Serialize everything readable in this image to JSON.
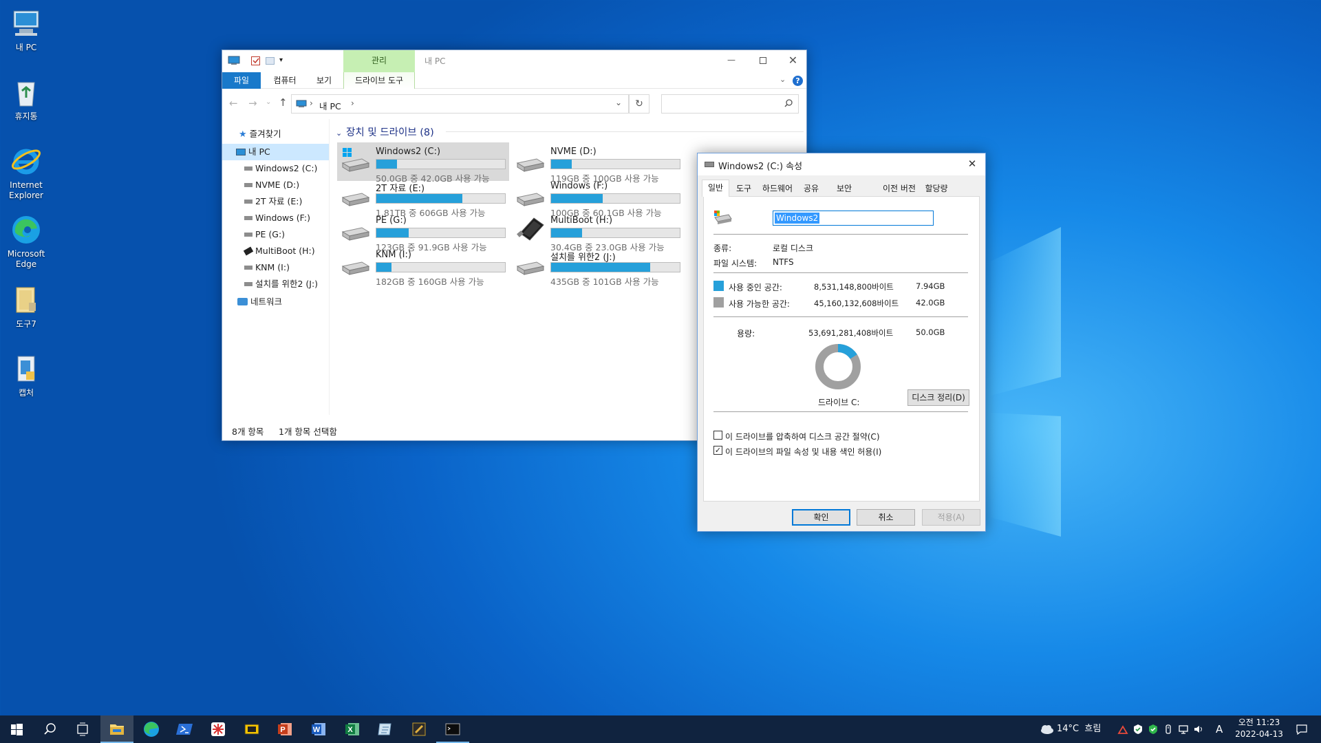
{
  "desktop": {
    "icons": [
      {
        "name": "my-pc",
        "label": "내 PC"
      },
      {
        "name": "recycle-bin",
        "label": "휴지통"
      },
      {
        "name": "internet-explorer",
        "label": "Internet Explorer"
      },
      {
        "name": "microsoft-edge",
        "label": "Microsoft Edge"
      },
      {
        "name": "tools-folder",
        "label": "도구7"
      },
      {
        "name": "capture",
        "label": "캡처"
      }
    ]
  },
  "explorer": {
    "title": "내 PC",
    "context_tab": "관리",
    "ribbon_tabs": [
      "파일",
      "컴퓨터",
      "보기",
      "드라이브 도구"
    ],
    "address": {
      "root": "내 PC"
    },
    "nav": {
      "favorites": "즐겨찾기",
      "this_pc": "내 PC",
      "drives": [
        "Windows2 (C:)",
        "NVME (D:)",
        "2T 자료 (E:)",
        "Windows (F:)",
        "PE (G:)",
        "MultiBoot (H:)",
        "KNM (I:)",
        "설치를 위한2 (J:)"
      ],
      "network": "네트워크"
    },
    "group_header": "장치 및 드라이브 (8)",
    "drives": [
      {
        "name": "Windows2 (C:)",
        "free_text": "50.0GB 중 42.0GB 사용 가능",
        "used_fraction": 0.16,
        "selected": true
      },
      {
        "name": "NVME (D:)",
        "free_text": "119GB 중 100GB 사용 가능",
        "used_fraction": 0.16
      },
      {
        "name": "2T 자료 (E:)",
        "free_text": "1.81TB 중 606GB 사용 가능",
        "used_fraction": 0.67
      },
      {
        "name": "Windows (F:)",
        "free_text": "100GB 중 60.1GB 사용 가능",
        "used_fraction": 0.4
      },
      {
        "name": "PE (G:)",
        "free_text": "123GB 중 91.9GB 사용 가능",
        "used_fraction": 0.25
      },
      {
        "name": "MultiBoot (H:)",
        "free_text": "30.4GB 중 23.0GB 사용 가능",
        "used_fraction": 0.24
      },
      {
        "name": "KNM (I:)",
        "free_text": "182GB 중 160GB 사용 가능",
        "used_fraction": 0.12
      },
      {
        "name": "설치를 위한2 (J:)",
        "free_text": "435GB 중 101GB 사용 가능",
        "used_fraction": 0.77
      }
    ],
    "status": {
      "items": "8개 항목",
      "selected": "1개 항목 선택함"
    }
  },
  "props": {
    "title": "Windows2 (C:) 속성",
    "tabs": [
      "일반",
      "도구",
      "하드웨어",
      "공유",
      "보안",
      "이전 버전",
      "할당량"
    ],
    "volume_name": "Windows2",
    "type_label": "종류:",
    "type_value": "로컬 디스크",
    "fs_label": "파일 시스템:",
    "fs_value": "NTFS",
    "used_label": "사용 중인 공간:",
    "used_bytes": "8,531,148,800바이트",
    "used_gb": "7.94GB",
    "free_label": "사용 가능한 공간:",
    "free_bytes": "45,160,132,608바이트",
    "free_gb": "42.0GB",
    "cap_label": "용량:",
    "cap_bytes": "53,691,281,408바이트",
    "cap_gb": "50.0GB",
    "used_fraction": 0.159,
    "drive_label": "드라이브 C:",
    "cleanup_button": "디스크 정리(D)",
    "compress_label": "이 드라이브를 압축하여 디스크 공간 절약(C)",
    "compress_checked": false,
    "index_label": "이 드라이브의 파일 속성 및 내용 색인 허용(I)",
    "index_checked": true,
    "ok": "확인",
    "cancel": "취소",
    "apply": "적용(A)",
    "colors": {
      "used": "#26a0da",
      "free": "#a0a0a0"
    }
  },
  "taskbar": {
    "apps": [
      "start-icon",
      "search-icon",
      "task-view-icon",
      "file-explorer-icon",
      "edge-icon",
      "powershell-icon",
      "app-icon",
      "chip-icon",
      "powerpoint-icon",
      "word-icon",
      "excel-icon",
      "notepad-icon",
      "tool-icon",
      "terminal-icon"
    ],
    "weather": "14°C  흐림",
    "ime": "A",
    "time": "오전 11:23",
    "date": "2022-04-13"
  }
}
